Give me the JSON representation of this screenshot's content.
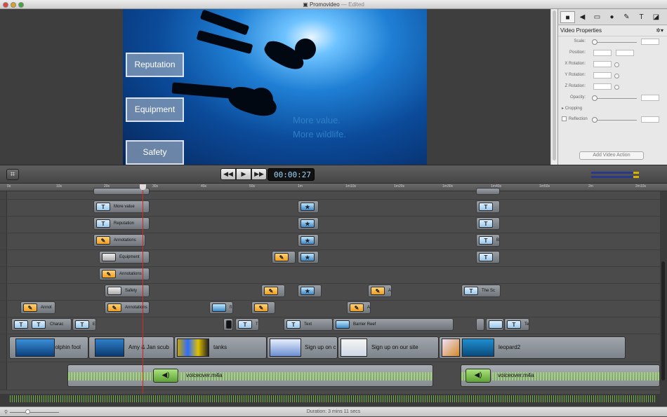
{
  "window": {
    "title": "Promovideo",
    "edited": "— Edited"
  },
  "canvas": {
    "overlays": [
      "Reputation",
      "Equipment",
      "Safety"
    ],
    "text_line1": "More value.",
    "text_line2": "More wildlife."
  },
  "inspector": {
    "tabs": [
      "video-icon",
      "audio-icon",
      "screen-icon",
      "cursor-icon",
      "annotation-icon",
      "text-icon",
      "callout-icon"
    ],
    "heading": "Video Properties",
    "fields": {
      "scale": "Scale:",
      "position": "Position:",
      "xrot": "X Rotation:",
      "yrot": "Y Rotation:",
      "zrot": "Z Rotation:",
      "opacity": "Opacity:",
      "cropping": "Cropping",
      "reflection": "Reflection"
    },
    "add_action": "Add Video Action"
  },
  "transport": {
    "time": "00:00:27",
    "frames": "17"
  },
  "ruler": [
    "0s",
    "10s",
    "20s",
    "30s",
    "40s",
    "50s",
    "1m",
    "1m10s",
    "1m20s",
    "1m30s",
    "1m40s",
    "1m50s",
    "2m",
    "2m10s"
  ],
  "clips": {
    "more_value": "More value",
    "reputation": "Reputation",
    "annotations": "Annotations",
    "equipment": "Equipment",
    "annotations2": "Annotations",
    "safety": "Safety",
    "annot": "Annot",
    "annotations3": "Annotations",
    "fl": "fl",
    "a1": "A",
    "a2": "A",
    "the_sc": "The Sc",
    "b": "B",
    "charac": "Charac",
    "e": "E",
    "t": "T",
    "text": "Text",
    "barrier_reef": "Barrier Reef",
    "te": "Te"
  },
  "video_clips": {
    "dolphin": "dolphin fool",
    "amy": "Amy & Jan scub",
    "tanks": "tanks",
    "signup1": "Sign up on c",
    "signup2": "Sign up on our site",
    "leopard": "leopard2"
  },
  "audio": {
    "clip1": "voiceover.m4a",
    "clip2": "voiceover.m4a"
  },
  "status": {
    "duration": "Duration: 3 mins 11 secs"
  }
}
